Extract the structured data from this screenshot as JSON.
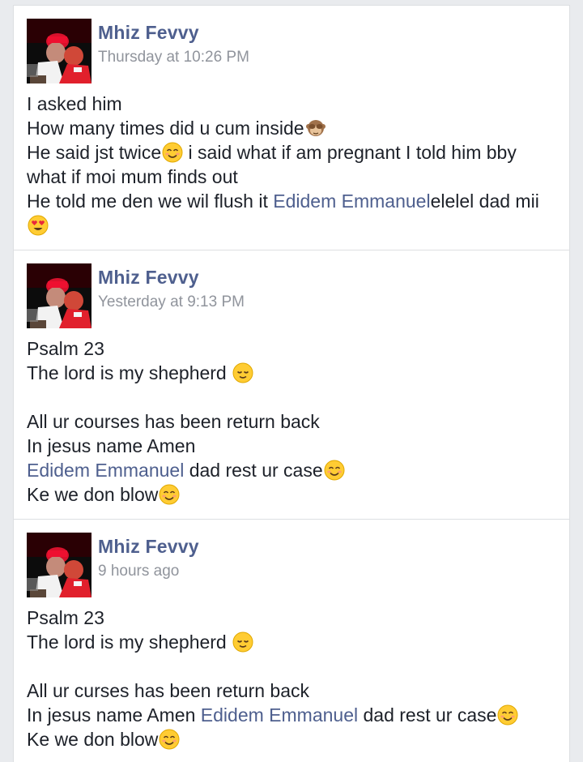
{
  "posts": [
    {
      "author": "Mhiz Fevvy",
      "timestamp": "Thursday at 10:26 PM",
      "lines": [
        {
          "t1": "I asked him"
        },
        {
          "t1": "How many times did u cum inside",
          "emoji": "see-no-evil-monkey-icon"
        },
        {
          "t1": "He said jst twice",
          "emoji": "smiling-face-icon",
          "t2": " i said what if am pregnant I told him bby"
        },
        {
          "t1": "what if moi mum finds out"
        },
        {
          "t1": "He told me den we wil flush it ",
          "link": "Edidem Emmanuel",
          "t2": "elelel dad mii"
        }
      ],
      "trailing_emoji": "heart-eyes-icon"
    },
    {
      "author": "Mhiz Fevvy",
      "timestamp": "Yesterday at 9:13 PM",
      "lines": [
        {
          "t1": "Psalm 23"
        },
        {
          "t1": "The lord is my shepherd ",
          "emoji": "relieved-face-icon"
        },
        {
          "t1": ""
        },
        {
          "t1": "All ur courses has been return back"
        },
        {
          "t1": "In jesus name Amen"
        },
        {
          "link": "Edidem Emmanuel",
          "t2": " dad rest ur case",
          "emoji": "smiling-face-icon"
        },
        {
          "t1": "Ke we don blow",
          "emoji": "smiling-face-icon"
        }
      ]
    },
    {
      "author": "Mhiz Fevvy",
      "timestamp": "9 hours ago",
      "lines": [
        {
          "t1": "Psalm 23"
        },
        {
          "t1": "The lord is my shepherd ",
          "emoji": "relieved-face-icon"
        },
        {
          "t1": ""
        },
        {
          "t1": "All ur curses has been return back"
        },
        {
          "t1": "In jesus name Amen ",
          "link": "Edidem Emmanuel",
          "t2": " dad rest ur case",
          "emoji": "smiling-face-icon"
        },
        {
          "t1": "Ke we don blow",
          "emoji": "smiling-face-icon"
        }
      ]
    }
  ],
  "colors": {
    "author": "#4e5f8e",
    "timestamp": "#90949c",
    "text": "#1d2129",
    "background": "#e9ebee"
  }
}
